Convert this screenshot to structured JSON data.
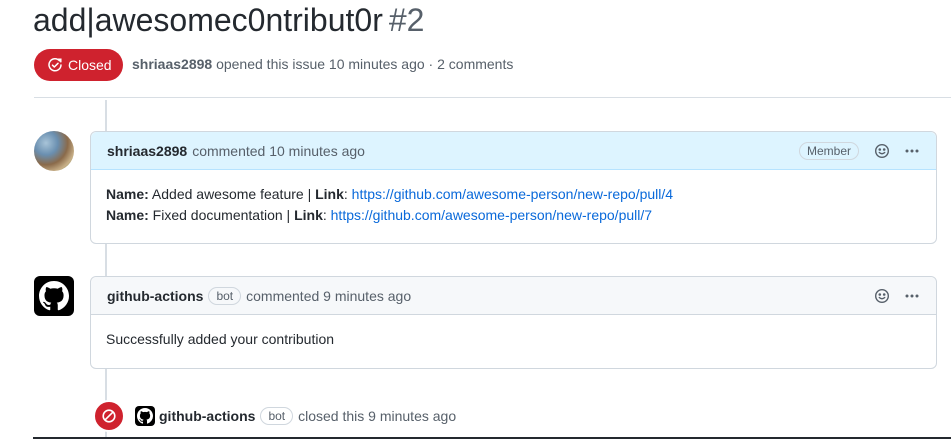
{
  "issue": {
    "title": "add|awesomec0ntribut0r",
    "number": "#2",
    "state": "Closed",
    "author": "shriaas2898",
    "meta_text": "opened this issue 10 minutes ago · 2 comments"
  },
  "comments": [
    {
      "author": "shriaas2898",
      "action": "commented 10 minutes ago",
      "role": "Member",
      "lines": [
        {
          "name_label": "Name:",
          "name_value": " Added awesome feature | ",
          "link_label": "Link",
          "sep": ": ",
          "url": "https://github.com/awesome-person/new-repo/pull/4"
        },
        {
          "name_label": "Name:",
          "name_value": " Fixed documentation | ",
          "link_label": "Link",
          "sep": ": ",
          "url": "https://github.com/awesome-person/new-repo/pull/7"
        }
      ]
    },
    {
      "author": "github-actions",
      "bot_label": "bot",
      "action": "commented 9 minutes ago",
      "body": "Successfully added your contribution"
    }
  ],
  "close_event": {
    "actor": "github-actions",
    "bot_label": "bot",
    "action": "closed this 9 minutes ago"
  },
  "colors": {
    "closed_red": "#cf222e",
    "link_blue": "#0969da",
    "member_header_bg": "#ddf4ff"
  },
  "icons": [
    "issue-closed-icon",
    "smiley-icon",
    "kebab-horizontal-icon",
    "github-mark-icon",
    "circle-slash-icon"
  ]
}
